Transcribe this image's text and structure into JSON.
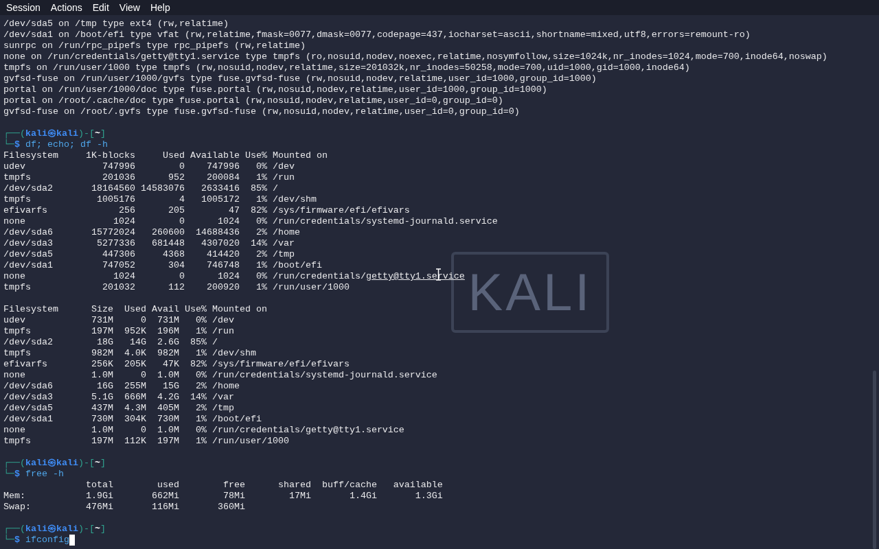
{
  "menu": [
    "Session",
    "Actions",
    "Edit",
    "View",
    "Help"
  ],
  "wallpaper": {
    "logo_text": "KALI"
  },
  "lines": [
    {
      "kind": "text",
      "text": "/dev/sda5 on /tmp type ext4 (rw,relatime)"
    },
    {
      "kind": "text",
      "text": "/dev/sda1 on /boot/efi type vfat (rw,relatime,fmask=0077,dmask=0077,codepage=437,iocharset=ascii,shortname=mixed,utf8,errors=remount-ro)"
    },
    {
      "kind": "text",
      "text": "sunrpc on /run/rpc_pipefs type rpc_pipefs (rw,relatime)"
    },
    {
      "kind": "text",
      "text": "none on /run/credentials/getty@tty1.service type tmpfs (ro,nosuid,nodev,noexec,relatime,nosymfollow,size=1024k,nr_inodes=1024,mode=700,inode64,noswap)"
    },
    {
      "kind": "text",
      "text": "tmpfs on /run/user/1000 type tmpfs (rw,nosuid,nodev,relatime,size=201032k,nr_inodes=50258,mode=700,uid=1000,gid=1000,inode64)"
    },
    {
      "kind": "text",
      "text": "gvfsd-fuse on /run/user/1000/gvfs type fuse.gvfsd-fuse (rw,nosuid,nodev,relatime,user_id=1000,group_id=1000)"
    },
    {
      "kind": "text",
      "text": "portal on /run/user/1000/doc type fuse.portal (rw,nosuid,nodev,relatime,user_id=1000,group_id=1000)"
    },
    {
      "kind": "text",
      "text": "portal on /root/.cache/doc type fuse.portal (rw,nosuid,nodev,relatime,user_id=0,group_id=0)"
    },
    {
      "kind": "text",
      "text": "gvfsd-fuse on /root/.gvfs type fuse.gvfsd-fuse (rw,nosuid,nodev,relatime,user_id=0,group_id=0)"
    },
    {
      "kind": "blank"
    },
    {
      "kind": "prompt",
      "frame_open": "┌──(",
      "user": "kali㉿kali",
      "frame_mid": ")-[",
      "dir": "~",
      "frame_close": "]",
      "frame_down": "└─",
      "sign": "$",
      "command": "df; echo; df -h",
      "cursor": false
    },
    {
      "kind": "text",
      "text": "Filesystem     1K-blocks     Used Available Use% Mounted on"
    },
    {
      "kind": "text",
      "text": "udev              747996        0    747996   0% /dev"
    },
    {
      "kind": "text",
      "text": "tmpfs             201036      952    200084   1% /run"
    },
    {
      "kind": "text",
      "text": "/dev/sda2       18164560 14583076   2633416  85% /"
    },
    {
      "kind": "text",
      "text": "tmpfs            1005176        4   1005172   1% /dev/shm"
    },
    {
      "kind": "text",
      "text": "efivarfs             256      205        47  82% /sys/firmware/efi/efivars"
    },
    {
      "kind": "text",
      "text": "none                1024        0      1024   0% /run/credentials/systemd-journald.service"
    },
    {
      "kind": "text",
      "text": "/dev/sda6       15772024   260600  14688436   2% /home"
    },
    {
      "kind": "text",
      "text": "/dev/sda3        5277336   681448   4307020  14% /var"
    },
    {
      "kind": "text",
      "text": "/dev/sda5         447306     4368    414420   2% /tmp"
    },
    {
      "kind": "text",
      "text": "/dev/sda1         747052      304    746748   1% /boot/efi"
    },
    {
      "kind": "text",
      "text": "none                1024        0      1024   0% /run/credentials/",
      "link": "getty@tty1.service"
    },
    {
      "kind": "text",
      "text": "tmpfs             201032      112    200920   1% /run/user/1000"
    },
    {
      "kind": "blank"
    },
    {
      "kind": "text",
      "text": "Filesystem      Size  Used Avail Use% Mounted on"
    },
    {
      "kind": "text",
      "text": "udev            731M     0  731M   0% /dev"
    },
    {
      "kind": "text",
      "text": "tmpfs           197M  952K  196M   1% /run"
    },
    {
      "kind": "text",
      "text": "/dev/sda2        18G   14G  2.6G  85% /"
    },
    {
      "kind": "text",
      "text": "tmpfs           982M  4.0K  982M   1% /dev/shm"
    },
    {
      "kind": "text",
      "text": "efivarfs        256K  205K   47K  82% /sys/firmware/efi/efivars"
    },
    {
      "kind": "text",
      "text": "none            1.0M     0  1.0M   0% /run/credentials/systemd-journald.service"
    },
    {
      "kind": "text",
      "text": "/dev/sda6        16G  255M   15G   2% /home"
    },
    {
      "kind": "text",
      "text": "/dev/sda3       5.1G  666M  4.2G  14% /var"
    },
    {
      "kind": "text",
      "text": "/dev/sda5       437M  4.3M  405M   2% /tmp"
    },
    {
      "kind": "text",
      "text": "/dev/sda1       730M  304K  730M   1% /boot/efi"
    },
    {
      "kind": "text",
      "text": "none            1.0M     0  1.0M   0% /run/credentials/getty@tty1.service"
    },
    {
      "kind": "text",
      "text": "tmpfs           197M  112K  197M   1% /run/user/1000"
    },
    {
      "kind": "blank"
    },
    {
      "kind": "prompt",
      "frame_open": "┌──(",
      "user": "kali㉿kali",
      "frame_mid": ")-[",
      "dir": "~",
      "frame_close": "]",
      "frame_down": "└─",
      "sign": "$",
      "command": "free -h",
      "cursor": false
    },
    {
      "kind": "text",
      "text": "               total        used        free      shared  buff/cache   available"
    },
    {
      "kind": "text",
      "text": "Mem:           1.9Gi       662Mi        78Mi        17Mi       1.4Gi       1.3Gi"
    },
    {
      "kind": "text",
      "text": "Swap:          476Mi       116Mi       360Mi"
    },
    {
      "kind": "blank"
    },
    {
      "kind": "prompt",
      "frame_open": "┌──(",
      "user": "kali㉿kali",
      "frame_mid": ")-[",
      "dir": "~",
      "frame_close": "]",
      "frame_down": "└─",
      "sign": "$",
      "command": "ifconfig",
      "cursor": true
    }
  ]
}
